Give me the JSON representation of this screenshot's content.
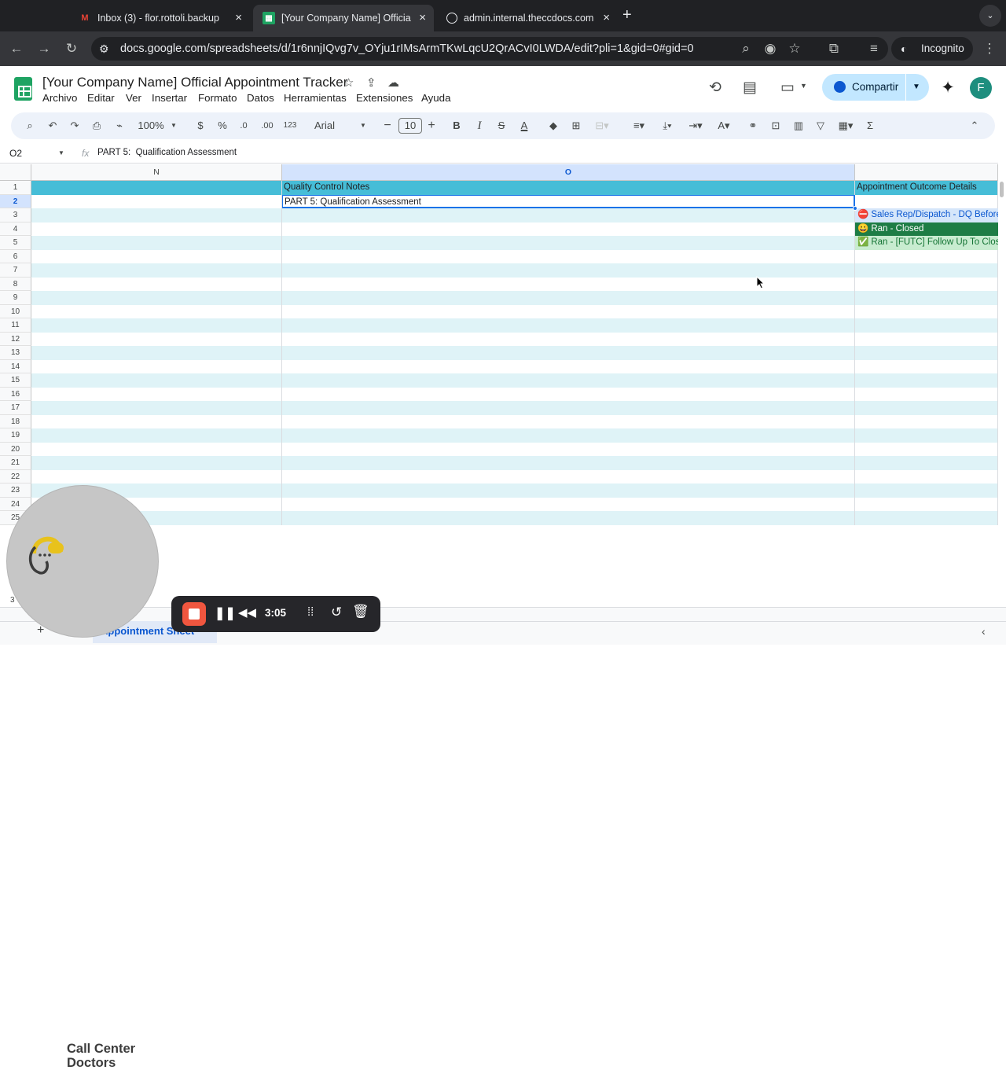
{
  "browser": {
    "tabs": [
      {
        "favicon": "gmail-icon",
        "title": "Inbox (3) - flor.rottoli.backup",
        "active": false
      },
      {
        "favicon": "sheets-icon",
        "title": "[Your Company Name] Officia",
        "active": true
      },
      {
        "favicon": "globe-icon",
        "title": "admin.internal.theccdocs.com",
        "active": false
      }
    ],
    "new_tab": "+",
    "url": "docs.google.com/spreadsheets/d/1r6nnjIQvg7v_OYju1rIMsArmTKwLqcU2QrACvI0LWDA/edit?pli=1&gid=0#gid=0",
    "incognito_label": "Incognito"
  },
  "doc": {
    "title": "[Your Company Name] Official Appointment Tracker",
    "menus": [
      "Archivo",
      "Editar",
      "Ver",
      "Insertar",
      "Formato",
      "Datos",
      "Herramientas",
      "Extensiones",
      "Ayuda"
    ],
    "share_label": "Compartir",
    "avatar_letter": "F"
  },
  "toolbar": {
    "zoom": "100%",
    "currency": "$",
    "percent": "%",
    "dec_decrease": ".0",
    "dec_increase": ".00",
    "number_format": "123",
    "font": "Arial",
    "font_size": "10",
    "bold": "B",
    "italic": "I",
    "strike": "S",
    "text_color": "A",
    "sum": "Σ"
  },
  "formula_bar": {
    "cell_ref": "O2",
    "fx": "fx",
    "value": "PART 5:  Qualification Assessment"
  },
  "grid": {
    "columns": [
      "N",
      "O"
    ],
    "row_numbers": [
      "1",
      "2",
      "3",
      "4",
      "5",
      "6",
      "7",
      "8",
      "9",
      "10",
      "11",
      "12",
      "13",
      "14",
      "15",
      "16",
      "17",
      "18",
      "19",
      "20",
      "21",
      "22",
      "23",
      "24",
      "25"
    ],
    "cells": {
      "O1": "Quality Control Notes",
      "P1": "Appointment Outcome Details",
      "O2": "PART 5:  Qualification Assessment"
    },
    "outcomes": [
      {
        "icon": "⛔",
        "label": "Sales Rep/Dispatch - DQ Before Appointment"
      },
      {
        "icon": "😀",
        "label": "Ran - Closed"
      },
      {
        "icon": "✅",
        "label": "Ran -  [FUTC] Follow Up To Close"
      }
    ],
    "partial_row_label": "3"
  },
  "footer": {
    "add_sheet": "+",
    "sheet_tab": "Appointment Sheet"
  },
  "overlay": {
    "logo_line1": "Call Center",
    "logo_line2": "Doctors",
    "recording_time": "3:05"
  },
  "colors": {
    "header_cyan": "#46bdd7",
    "band_light": "#dff3f7",
    "green_dark": "#1e7d45",
    "green_light": "#c8ecd0",
    "blue_light": "#d5e6fa"
  }
}
